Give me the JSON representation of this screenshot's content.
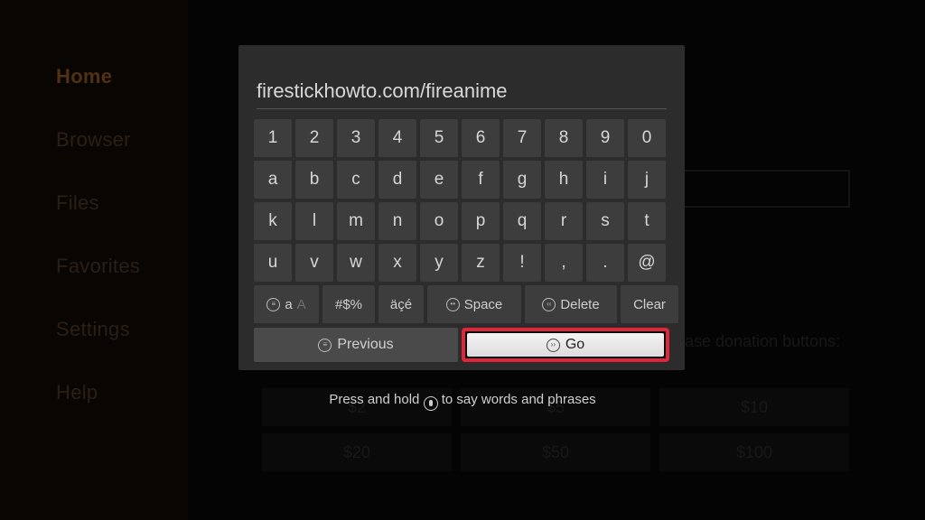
{
  "sidebar": {
    "items": [
      {
        "label": "Home"
      },
      {
        "label": "Browser"
      },
      {
        "label": "Files"
      },
      {
        "label": "Favorites"
      },
      {
        "label": "Settings"
      },
      {
        "label": "Help"
      }
    ]
  },
  "background": {
    "donation_label": "ase donation buttons:",
    "amounts": [
      "$2",
      "$5",
      "$10",
      "$20",
      "$50",
      "$100"
    ]
  },
  "keyboard": {
    "input_value": "firestickhowto.com/fireanime",
    "rows": [
      [
        "1",
        "2",
        "3",
        "4",
        "5",
        "6",
        "7",
        "8",
        "9",
        "0"
      ],
      [
        "a",
        "b",
        "c",
        "d",
        "e",
        "f",
        "g",
        "h",
        "i",
        "j"
      ],
      [
        "k",
        "l",
        "m",
        "n",
        "o",
        "p",
        "q",
        "r",
        "s",
        "t"
      ],
      [
        "u",
        "v",
        "w",
        "x",
        "y",
        "z",
        "!",
        ",",
        ".",
        "@"
      ]
    ],
    "fn": {
      "case_icon": "≡",
      "case_lower": "a",
      "case_upper": "A",
      "symbols": "#$%",
      "accents": "äçé",
      "space": "Space",
      "delete": "Delete",
      "clear": "Clear"
    },
    "nav": {
      "previous": "Previous",
      "go": "Go"
    },
    "hint_before": "Press and hold",
    "hint_after": "to say words and phrases"
  }
}
